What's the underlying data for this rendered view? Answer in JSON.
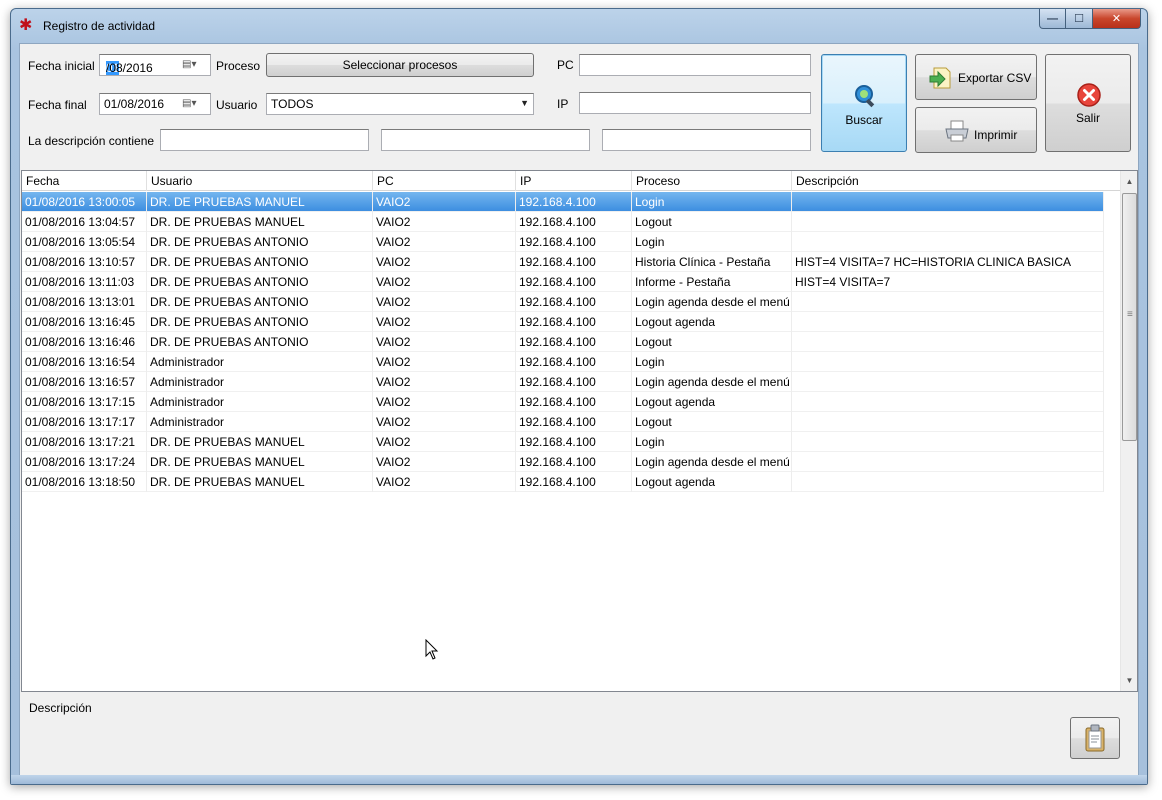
{
  "window": {
    "title": "Registro de actividad",
    "icon": "asterisk-app-icon",
    "min_glyph": "—",
    "max_glyph": "☐",
    "close_glyph": "✕"
  },
  "filters": {
    "fecha_inicial_label": "Fecha inicial",
    "fecha_inicial_sel": "01",
    "fecha_inicial_rest": "/08/2016",
    "fecha_final_label": "Fecha final",
    "fecha_final_value": "01/08/2016",
    "proceso_label": "Proceso",
    "proceso_button": "Seleccionar procesos",
    "usuario_label": "Usuario",
    "usuario_value": "TODOS",
    "pc_label": "PC",
    "pc_value": "",
    "ip_label": "IP",
    "ip_value": "",
    "descripcion_label": "La descripción contiene",
    "descripcion_value_1": "",
    "descripcion_value_2": "",
    "descripcion_value_3": ""
  },
  "actions": {
    "buscar": "Buscar",
    "exportar": "Exportar CSV",
    "imprimir": "Imprimir",
    "salir": "Salir"
  },
  "table": {
    "columns": [
      "Fecha",
      "Usuario",
      "PC",
      "IP",
      "Proceso",
      "Descripción"
    ],
    "rows": [
      [
        "01/08/2016 13:00:05",
        "DR. DE PRUEBAS MANUEL",
        "VAIO2",
        "192.168.4.100",
        "Login",
        ""
      ],
      [
        "01/08/2016 13:04:57",
        "DR. DE PRUEBAS MANUEL",
        "VAIO2",
        "192.168.4.100",
        "Logout",
        ""
      ],
      [
        "01/08/2016 13:05:54",
        "DR. DE PRUEBAS ANTONIO",
        "VAIO2",
        "192.168.4.100",
        "Login",
        ""
      ],
      [
        "01/08/2016 13:10:57",
        "DR. DE PRUEBAS ANTONIO",
        "VAIO2",
        "192.168.4.100",
        "Historia Clínica - Pestaña",
        "HIST=4 VISITA=7 HC=HISTORIA CLINICA BASICA"
      ],
      [
        "01/08/2016 13:11:03",
        "DR. DE PRUEBAS ANTONIO",
        "VAIO2",
        "192.168.4.100",
        "Informe - Pestaña",
        "HIST=4 VISITA=7"
      ],
      [
        "01/08/2016 13:13:01",
        "DR. DE PRUEBAS ANTONIO",
        "VAIO2",
        "192.168.4.100",
        "Login agenda desde el menú",
        ""
      ],
      [
        "01/08/2016 13:16:45",
        "DR. DE PRUEBAS ANTONIO",
        "VAIO2",
        "192.168.4.100",
        "Logout agenda",
        ""
      ],
      [
        "01/08/2016 13:16:46",
        "DR. DE PRUEBAS ANTONIO",
        "VAIO2",
        "192.168.4.100",
        "Logout",
        ""
      ],
      [
        "01/08/2016 13:16:54",
        "Administrador",
        "VAIO2",
        "192.168.4.100",
        "Login",
        ""
      ],
      [
        "01/08/2016 13:16:57",
        "Administrador",
        "VAIO2",
        "192.168.4.100",
        "Login agenda desde el menú",
        ""
      ],
      [
        "01/08/2016 13:17:15",
        "Administrador",
        "VAIO2",
        "192.168.4.100",
        "Logout agenda",
        ""
      ],
      [
        "01/08/2016 13:17:17",
        "Administrador",
        "VAIO2",
        "192.168.4.100",
        "Logout",
        ""
      ],
      [
        "01/08/2016 13:17:21",
        "DR. DE PRUEBAS MANUEL",
        "VAIO2",
        "192.168.4.100",
        "Login",
        ""
      ],
      [
        "01/08/2016 13:17:24",
        "DR. DE PRUEBAS MANUEL",
        "VAIO2",
        "192.168.4.100",
        "Login agenda desde el menú",
        ""
      ],
      [
        "01/08/2016 13:18:50",
        "DR. DE PRUEBAS MANUEL",
        "VAIO2",
        "192.168.4.100",
        "Logout agenda",
        ""
      ]
    ],
    "selected_row": 0
  },
  "detail": {
    "label": "Descripción",
    "copy_icon": "clipboard-icon"
  },
  "colors": {
    "selection": "#3d8ee0",
    "close": "#c9462c"
  }
}
